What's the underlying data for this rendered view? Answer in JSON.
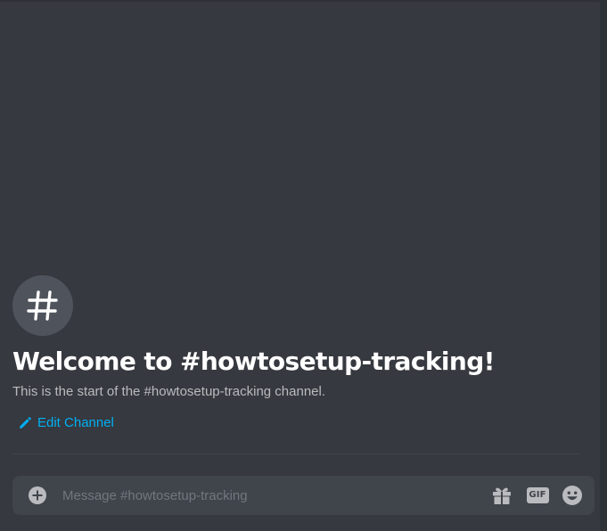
{
  "welcome": {
    "title": "Welcome to #howtosetup-tracking!",
    "subtitle": "This is the start of the #howtosetup-tracking channel.",
    "edit_label": "Edit Channel",
    "avatar_icon": "hashtag-icon"
  },
  "composer": {
    "placeholder": "Message #howtosetup-tracking",
    "value": "",
    "gif_label": "GIF",
    "icons": [
      "add-circle-icon",
      "gift-icon",
      "gif-icon",
      "emoji-icon"
    ]
  },
  "colors": {
    "background": "#36393f",
    "composer_bg": "#40444b",
    "link": "#00b0f4",
    "avatar_bg": "#4f545c"
  }
}
